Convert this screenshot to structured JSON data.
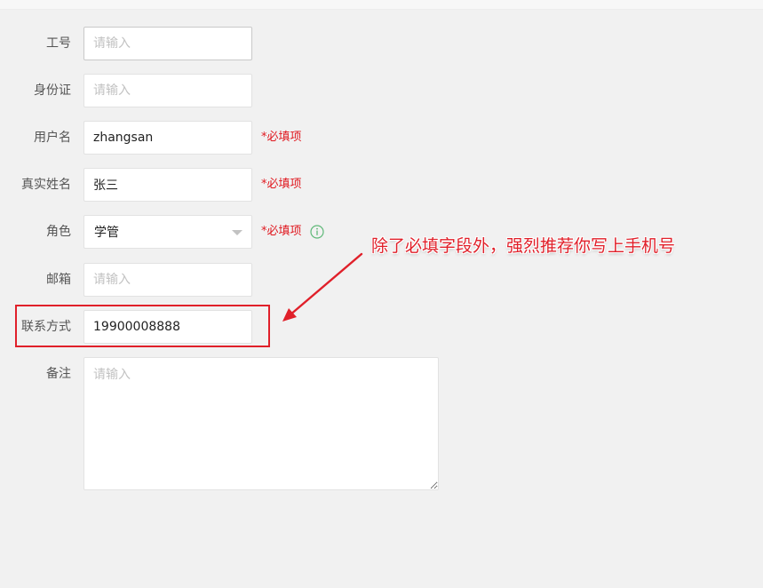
{
  "form": {
    "employee_no": {
      "label": "工号",
      "value": "",
      "placeholder": "请输入"
    },
    "id_card": {
      "label": "身份证",
      "value": "",
      "placeholder": "请输入"
    },
    "username": {
      "label": "用户名",
      "value": "zhangsan",
      "placeholder": "",
      "required_text": "*必填项"
    },
    "real_name": {
      "label": "真实姓名",
      "value": "张三",
      "placeholder": "",
      "required_text": "*必填项"
    },
    "role": {
      "label": "角色",
      "selected": "学管",
      "required_text": "*必填项",
      "info_icon": "info-icon"
    },
    "email": {
      "label": "邮箱",
      "value": "",
      "placeholder": "请输入"
    },
    "contact": {
      "label": "联系方式",
      "value": "19900008888",
      "placeholder": ""
    },
    "remark": {
      "label": "备注",
      "value": "",
      "placeholder": "请输入"
    }
  },
  "annotation": {
    "callout_text": "除了必填字段外，强烈推荐你写上手机号",
    "color": "#e0202a"
  },
  "colors": {
    "background": "#f1f1f1",
    "required": "#e0181f",
    "info_icon": "#5fb878"
  }
}
